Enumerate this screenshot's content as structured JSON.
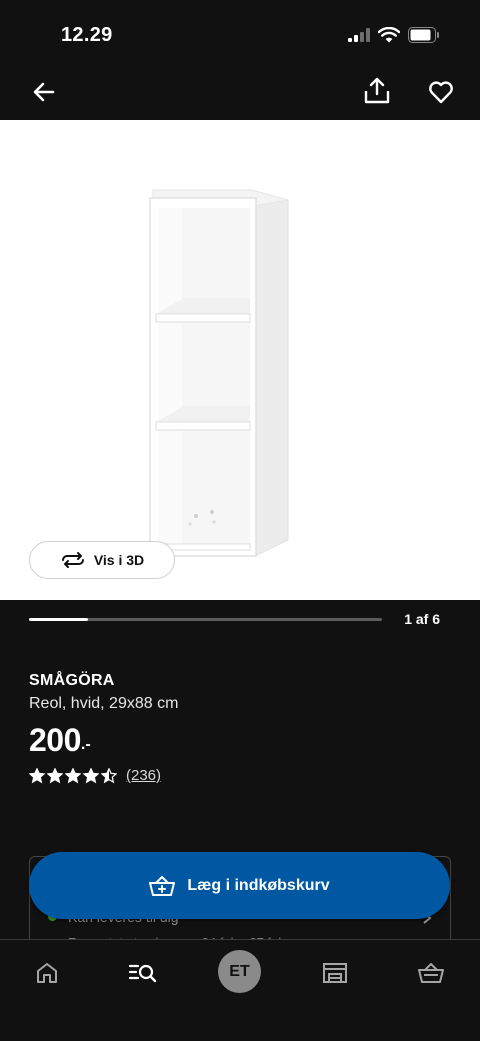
{
  "status_bar": {
    "time": "12.29"
  },
  "gallery": {
    "view_3d_label": "Vis i 3D",
    "page_indicator": "1 af 6",
    "progress": 0.167
  },
  "product": {
    "name": "SMÅGÖRA",
    "description": "Reol, hvid, 29x88 cm",
    "price_integer": "200",
    "price_suffix": ".-",
    "rating": 4.5,
    "review_count": "(236)"
  },
  "availability": {
    "line1": "Kan leveres til dig",
    "line2": "Forventet at ankomme 24.feb - 27.feb"
  },
  "cart": {
    "add_label": "Læg i indkøbskurv"
  },
  "bottom_nav": {
    "avatar_initials": "ET"
  },
  "colors": {
    "background": "#111111",
    "accent_blue": "#0058a3",
    "stock_green": "#3b9c3b"
  }
}
